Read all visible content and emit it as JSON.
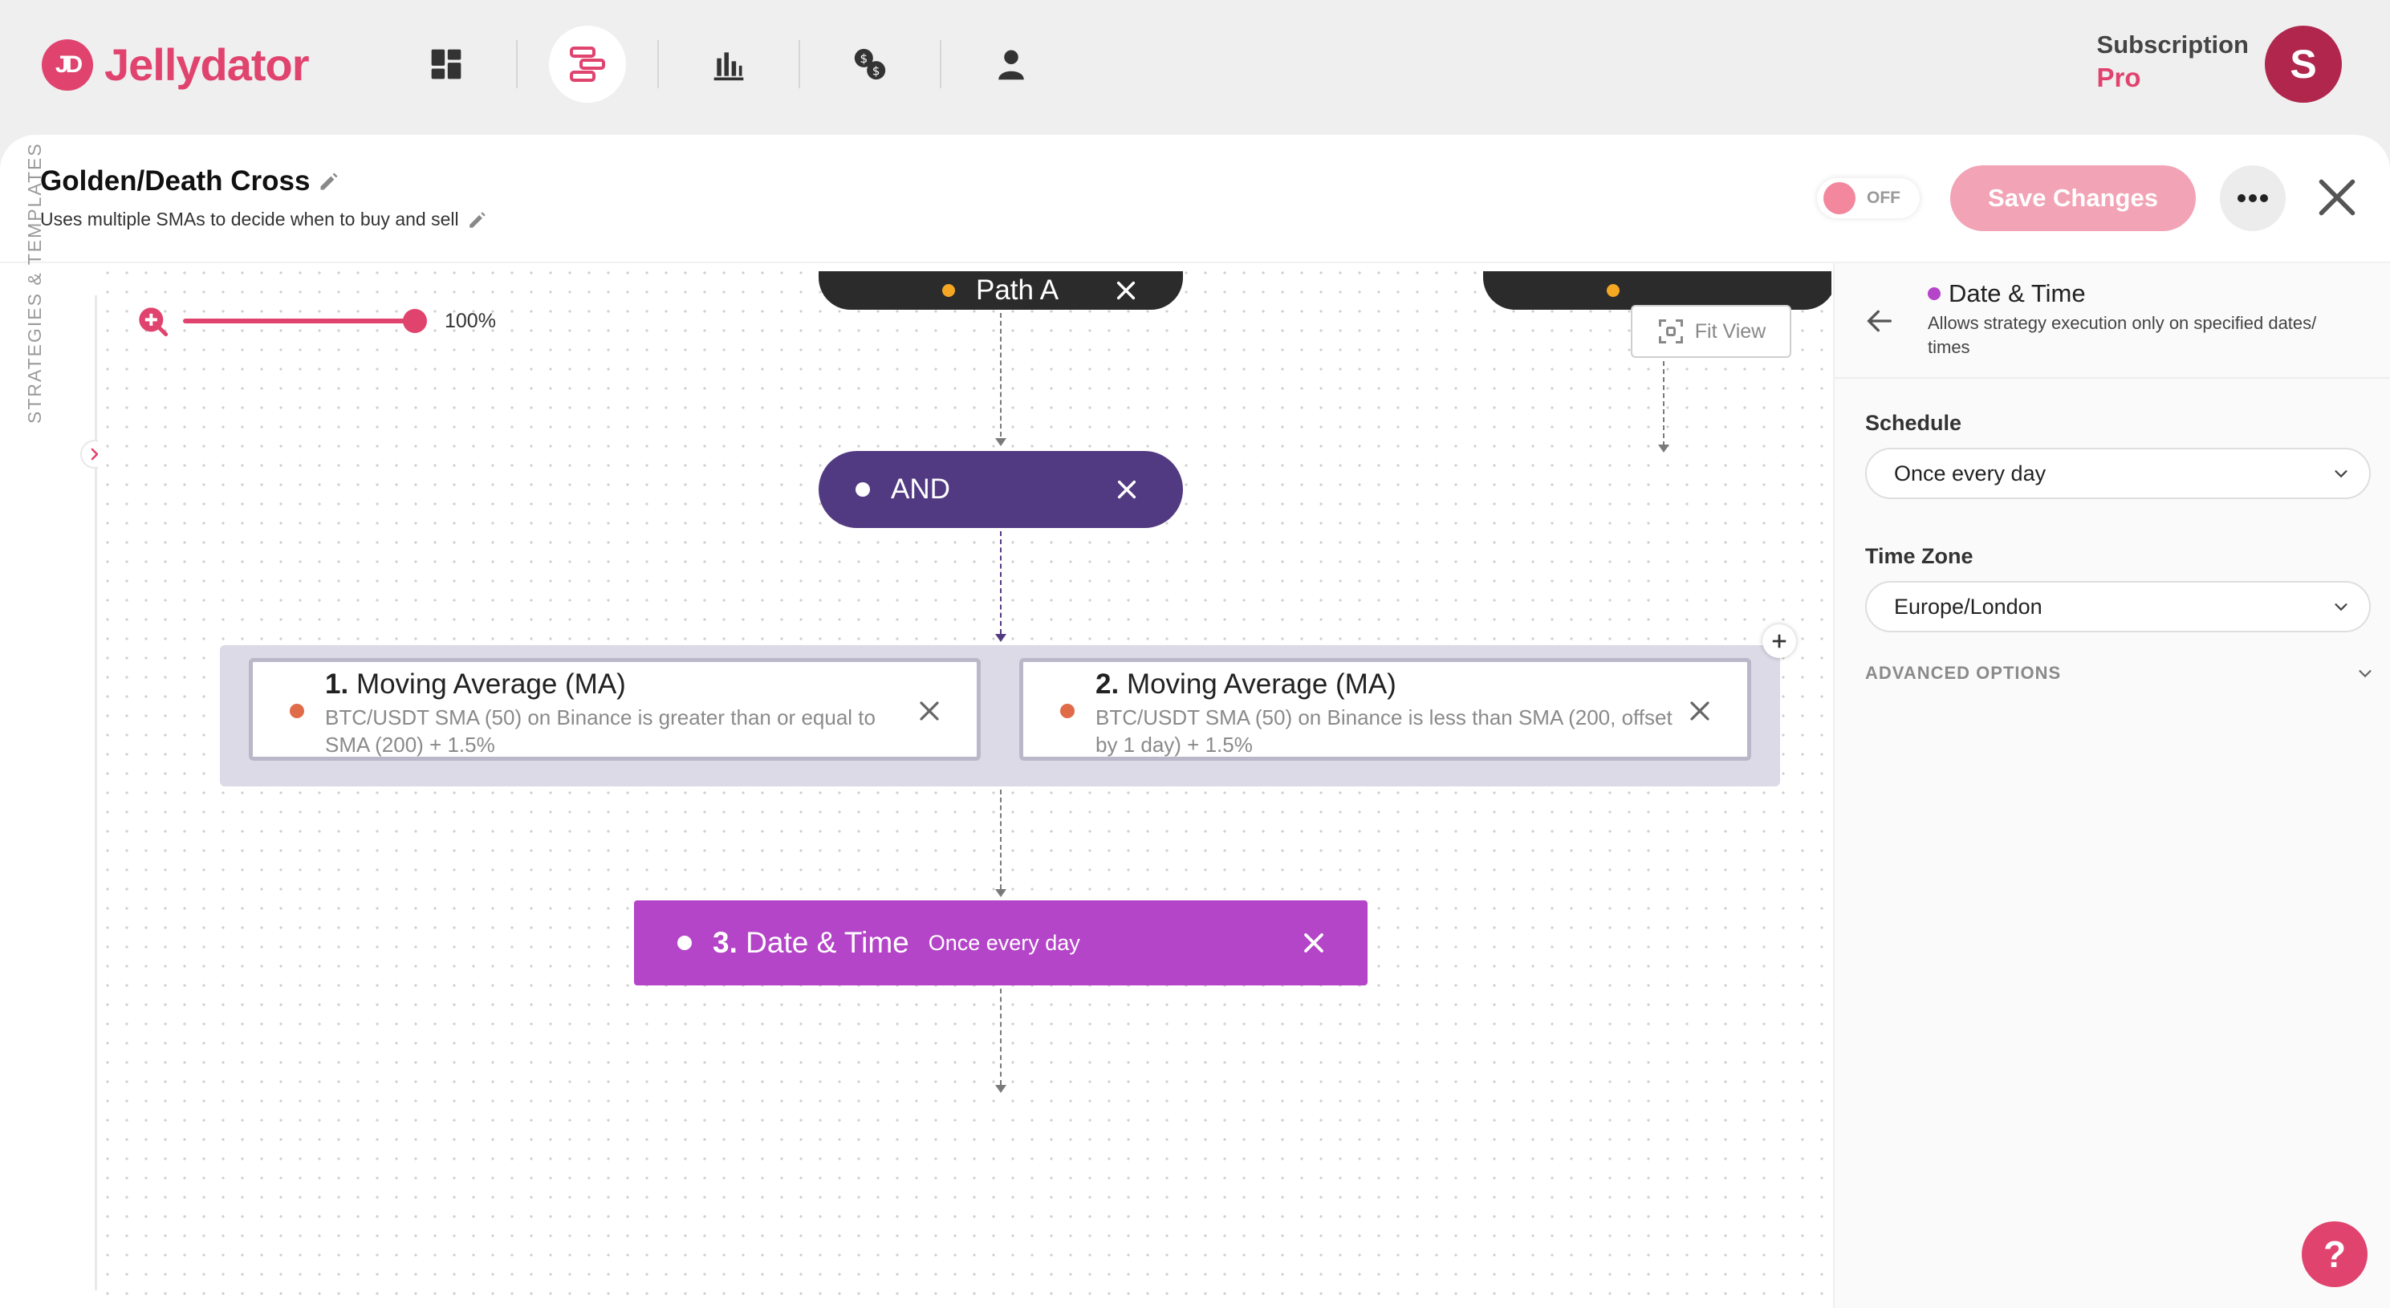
{
  "app": {
    "name": "Jellydator",
    "logo_mark": "JD"
  },
  "nav": {
    "items": [
      {
        "name": "dashboard-icon",
        "active": false
      },
      {
        "name": "strategies-icon",
        "active": true
      },
      {
        "name": "charts-icon",
        "active": false
      },
      {
        "name": "exchange-icon",
        "active": false
      },
      {
        "name": "account-icon",
        "active": false
      }
    ]
  },
  "user": {
    "subscription_label": "Subscription",
    "plan": "Pro",
    "avatar_initial": "S"
  },
  "strategy": {
    "title": "Golden/Death Cross",
    "description": "Uses multiple SMAs to decide when to buy and sell",
    "toggle_label": "OFF",
    "save_label": "Save Changes"
  },
  "rail": {
    "label": "STRATEGIES & TEMPLATES"
  },
  "canvas": {
    "zoom": "100%",
    "zoom_level": 1.0,
    "fit_view_label": "Fit View",
    "path_a_label": "Path A",
    "and_label": "AND",
    "conditions": [
      {
        "number": "1.",
        "title": "Moving Average (MA)",
        "description": "BTC/USDT SMA (50) on Binance is greater than or equal to SMA (200) + 1.5%"
      },
      {
        "number": "2.",
        "title": "Moving Average (MA)",
        "description": "BTC/USDT SMA (50) on Binance is less than SMA (200, offset by 1 day) + 1.5%"
      }
    ],
    "date_node": {
      "number": "3.",
      "title": "Date & Time",
      "subtitle": "Once every day"
    }
  },
  "side_panel": {
    "title": "Date & Time",
    "description": "Allows strategy execution only on specified dates/ times",
    "schedule_label": "Schedule",
    "schedule_value": "Once every day",
    "timezone_label": "Time Zone",
    "timezone_value": "Europe/London",
    "advanced_label": "ADVANCED OPTIONS"
  },
  "colors": {
    "brand": "#e0436e",
    "and_node": "#523a82",
    "date_node": "#b444c8",
    "condition_dot": "#e06b48",
    "path_dot": "#f5a623"
  }
}
